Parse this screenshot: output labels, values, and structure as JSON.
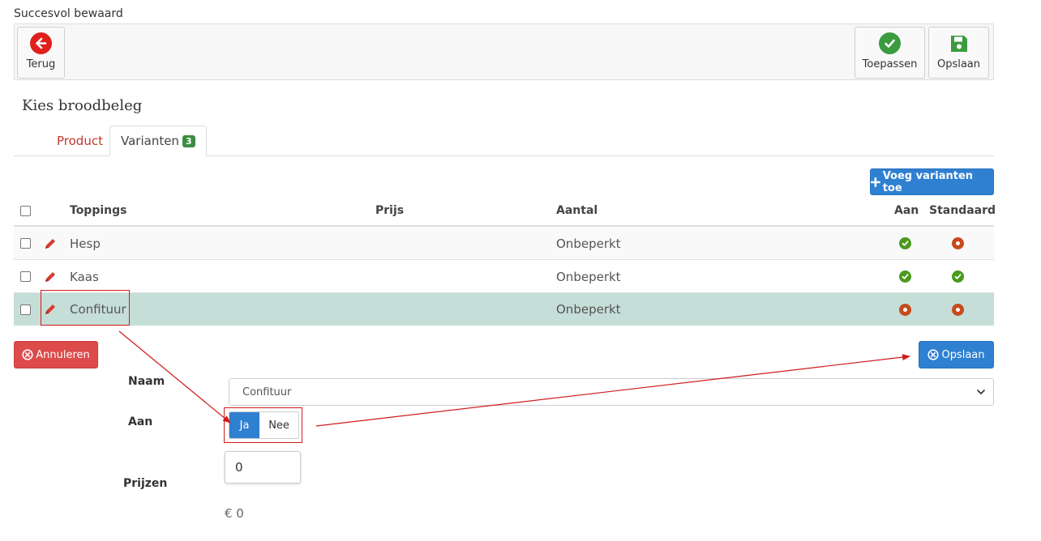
{
  "status": {
    "message": "Succesvol bewaard"
  },
  "toolbar": {
    "back_label": "Terug",
    "apply_label": "Toepassen",
    "save_label": "Opslaan"
  },
  "page": {
    "title": "Kies broodbeleg"
  },
  "tabs": {
    "product_label": "Product",
    "variants_label": "Varianten",
    "variants_count": "3"
  },
  "actions": {
    "add_variants_label": "Voeg varianten toe"
  },
  "table": {
    "headers": {
      "toppings": "Toppings",
      "price": "Prijs",
      "quantity": "Aantal",
      "on": "Aan",
      "default": "Standaard"
    },
    "rows": [
      {
        "name": "Hesp",
        "price": "",
        "quantity": "Onbeperkt",
        "on": true,
        "default": false
      },
      {
        "name": "Kaas",
        "price": "",
        "quantity": "Onbeperkt",
        "on": true,
        "default": true
      },
      {
        "name": "Confituur",
        "price": "",
        "quantity": "Onbeperkt",
        "on": false,
        "default": false,
        "selected": true
      }
    ]
  },
  "edit_form": {
    "cancel_label": "Annuleren",
    "save_label": "Opslaan",
    "name_label": "Naam",
    "name_value": "Confituur",
    "on_label": "Aan",
    "yes_label": "Ja",
    "no_label": "Nee",
    "prices_label": "Prijzen",
    "price_value": "0",
    "price_display": "€ 0"
  },
  "colors": {
    "selected_row": "#c5ded8",
    "accent_blue": "#2f80d1",
    "danger_red": "#dd4b4b",
    "success_green": "#4a9a1e",
    "annotation_red": "#d11a1a"
  }
}
